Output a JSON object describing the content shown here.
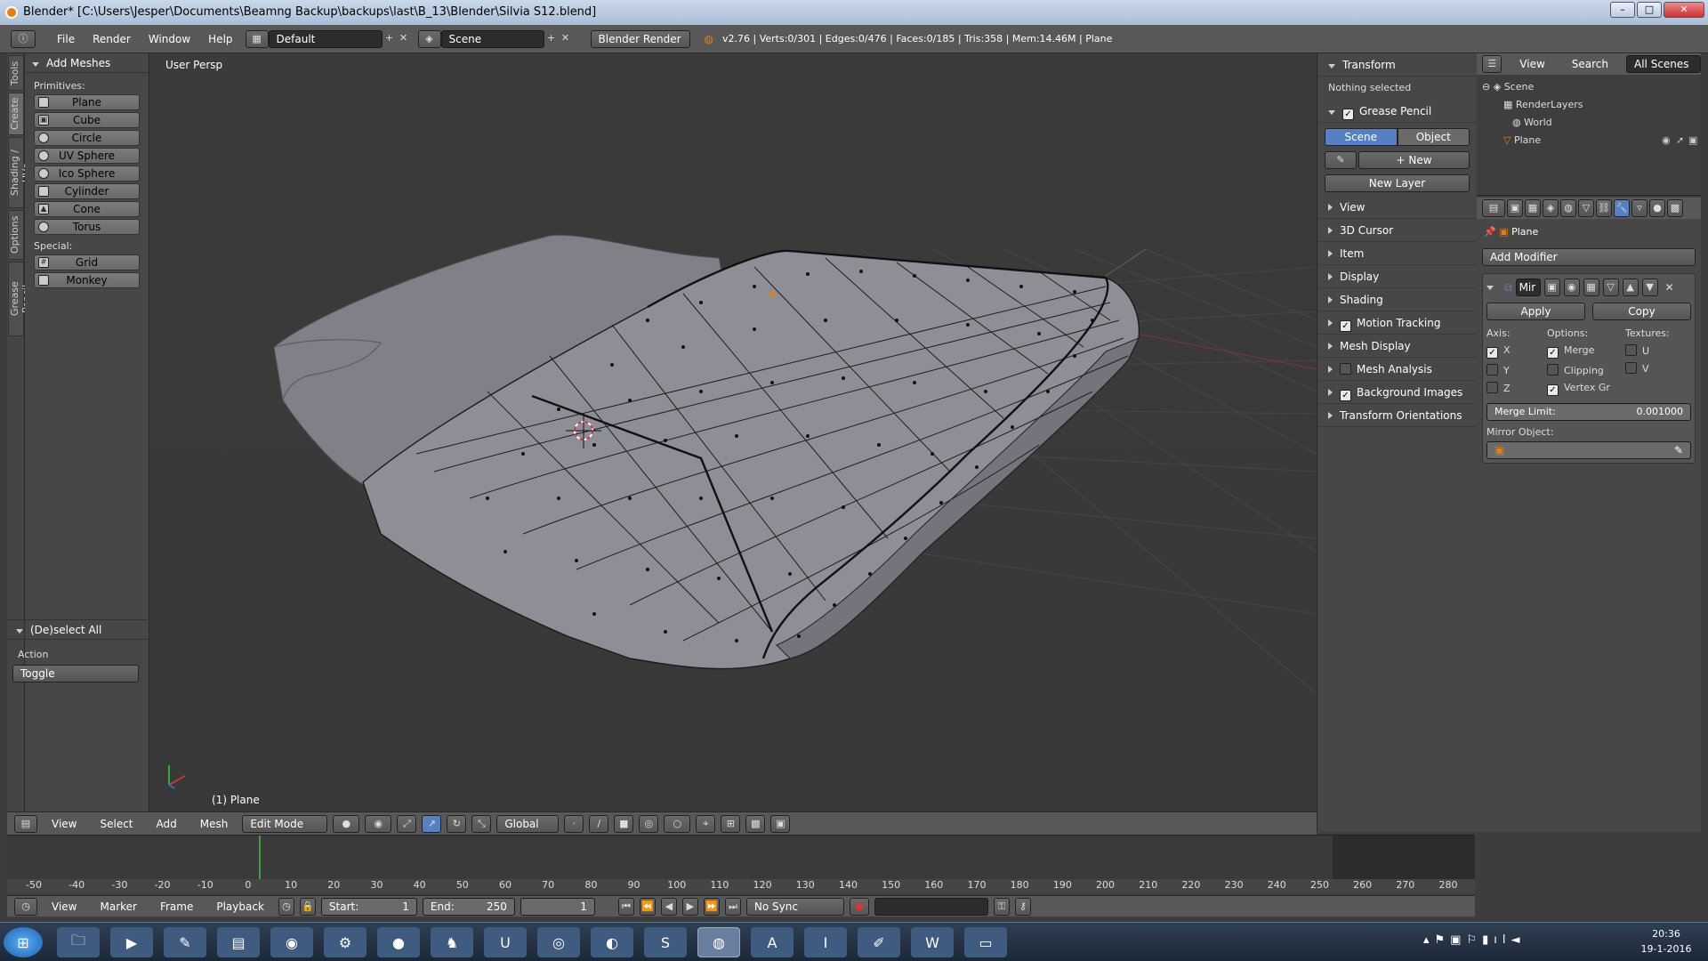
{
  "window": {
    "title": "Blender* [C:\\Users\\Jesper\\Documents\\Beamng Backup\\backups\\last\\B_13\\Blender\\Silvia S12.blend]"
  },
  "menubar": {
    "menus": [
      "File",
      "Render",
      "Window",
      "Help"
    ],
    "layout": "Default",
    "scene": "Scene",
    "engine": "Blender Render",
    "stats": "v2.76 | Verts:0/301 | Edges:0/476 | Faces:0/185 | Tris:358 | Mem:14.46M | Plane"
  },
  "left_tabs": [
    "Tools",
    "Create",
    "Shading / UVs",
    "Options",
    "Grease Pencil"
  ],
  "toolshelf": {
    "header": "Add Meshes",
    "primitives_label": "Primitives:",
    "primitives": [
      "Plane",
      "Cube",
      "Circle",
      "UV Sphere",
      "Ico Sphere",
      "Cylinder",
      "Cone",
      "Torus"
    ],
    "special_label": "Special:",
    "special": [
      "Grid",
      "Monkey"
    ],
    "operator_header": "(De)select All",
    "action_label": "Action",
    "action_value": "Toggle"
  },
  "viewport": {
    "view_name": "User Persp",
    "object_label": "(1) Plane"
  },
  "viewport_header": {
    "menus": [
      "View",
      "Select",
      "Add",
      "Mesh"
    ],
    "mode": "Edit Mode",
    "orientation": "Global"
  },
  "npanel": {
    "transform": "Transform",
    "nothing_selected": "Nothing selected",
    "grease_pencil": "Grease Pencil",
    "scene_tab": "Scene",
    "object_tab": "Object",
    "new_btn": "New",
    "new_layer_btn": "New Layer",
    "sections": [
      "View",
      "3D Cursor",
      "Item",
      "Display",
      "Shading",
      "Motion Tracking",
      "Mesh Display",
      "Mesh Analysis",
      "Background Images",
      "Transform Orientations"
    ]
  },
  "outliner": {
    "menus": [
      "View",
      "Search",
      "All Scenes"
    ],
    "items": [
      "Scene",
      "RenderLayers",
      "World",
      "Plane"
    ]
  },
  "properties": {
    "object_name": "Plane",
    "add_modifier": "Add Modifier",
    "modifier_name": "Mir",
    "apply": "Apply",
    "copy": "Copy",
    "axis_label": "Axis:",
    "options_label": "Options:",
    "textures_label": "Textures:",
    "axis": [
      "X",
      "Y",
      "Z"
    ],
    "options": [
      "Merge",
      "Clipping",
      "Vertex Gr"
    ],
    "textures": [
      "U",
      "V"
    ],
    "merge_limit_label": "Merge Limit:",
    "merge_limit_value": "0.001000",
    "mirror_object_label": "Mirror Object:"
  },
  "timeline": {
    "ticks": [
      "-50",
      "-40",
      "-30",
      "-20",
      "-10",
      "0",
      "10",
      "20",
      "30",
      "40",
      "50",
      "60",
      "70",
      "80",
      "90",
      "100",
      "110",
      "120",
      "130",
      "140",
      "150",
      "160",
      "170",
      "180",
      "190",
      "200",
      "210",
      "220",
      "230",
      "240",
      "250",
      "260",
      "270",
      "280"
    ],
    "menus": [
      "View",
      "Marker",
      "Frame",
      "Playback"
    ],
    "start": "Start:",
    "start_val": "1",
    "end": "End:",
    "end_val": "250",
    "current": "1",
    "sync": "No Sync"
  },
  "taskbar": {
    "time": "20:36",
    "date": "19-1-2016"
  },
  "colors": {
    "accent_blue": "#5680c2",
    "blender_orange": "#e87d0d",
    "mesh_gray": "#8a8a92"
  }
}
